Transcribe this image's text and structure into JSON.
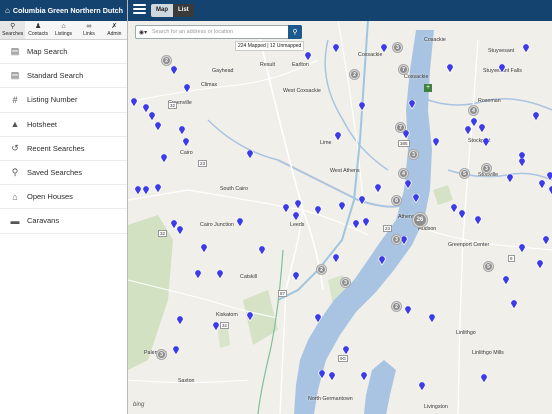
{
  "app": {
    "title": "Columbia Green Northern Dutch"
  },
  "tabs": [
    {
      "label": "Searches",
      "icon": "search-icon"
    },
    {
      "label": "Contacts",
      "icon": "contacts-icon"
    },
    {
      "label": "Listings",
      "icon": "listings-icon"
    },
    {
      "label": "Links",
      "icon": "links-icon"
    },
    {
      "label": "Admin",
      "icon": "wrench-icon"
    }
  ],
  "menu": [
    {
      "label": "Map Search",
      "icon": "map-icon"
    },
    {
      "label": "Standard Search",
      "icon": "document-icon"
    },
    {
      "label": "Listing Number",
      "icon": "hash-icon"
    },
    {
      "label": "Hotsheet",
      "icon": "hotsheet-icon"
    },
    {
      "label": "Recent Searches",
      "icon": "history-icon"
    },
    {
      "label": "Saved Searches",
      "icon": "saved-search-icon"
    },
    {
      "label": "Open Houses",
      "icon": "house-icon"
    },
    {
      "label": "Caravans",
      "icon": "car-icon"
    }
  ],
  "toolbar": {
    "map_label": "Map",
    "list_label": "List"
  },
  "search": {
    "placeholder": "Search for an address or location"
  },
  "map": {
    "mapped_status": "224 Mapped | 12 Unmapped",
    "attribution": "bing",
    "places": [
      "Gayhead",
      "Result",
      "Earlton",
      "Coxsackie",
      "Cosackie",
      "Stuyvesant Falls",
      "Climax",
      "Coxsackie",
      "Greenville",
      "Stuyvesant",
      "West Coxsackie",
      "Roseman",
      "Stockport",
      "Stottville",
      "Lime",
      "West Athens",
      "Cairo",
      "Athens",
      "Leeds",
      "South Cairo",
      "Hudson",
      "Cairo Junction",
      "Greenport Center",
      "Catskill",
      "Kiskatom",
      "Palenville",
      "Saxton",
      "Linlithgo",
      "Linlithgo Mills",
      "North Germantown",
      "Livingston"
    ],
    "clusters": [
      "2",
      "3",
      "2",
      "7",
      "4",
      "7",
      "3",
      "3",
      "4",
      "5",
      "8",
      "26",
      "3",
      "5",
      "2",
      "2",
      "3",
      "3"
    ],
    "zoom_in": "+"
  },
  "colors": {
    "header": "#15436f",
    "pin": "#3b3be8",
    "water": "#a9c4e2",
    "park": "#c6dcb1"
  }
}
